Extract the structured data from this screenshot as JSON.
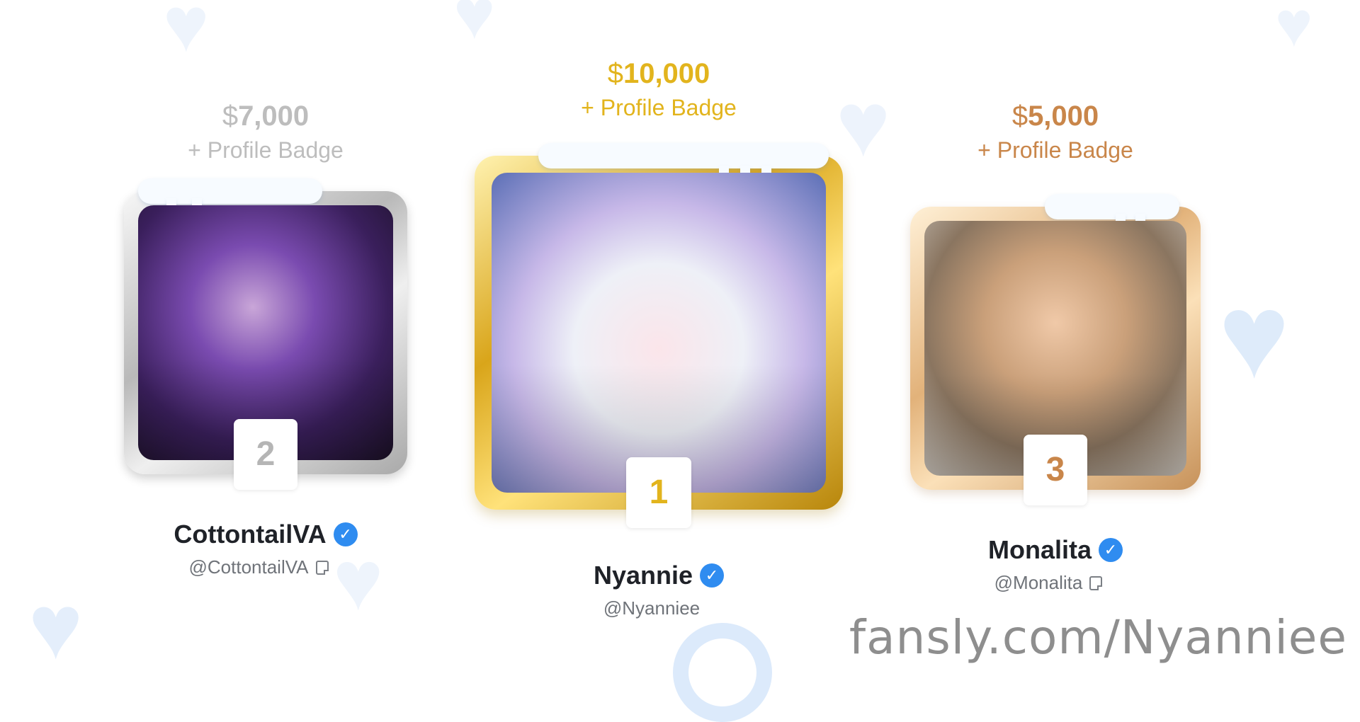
{
  "podium": [
    {
      "place": "second",
      "currency": "$",
      "amount": "7,000",
      "reward": "+ Profile Badge",
      "rank": "2",
      "name": "CottontailVA",
      "handle": "@CottontailVA",
      "verified": true,
      "frame_color": "#bdbdbd"
    },
    {
      "place": "first",
      "currency": "$",
      "amount": "10,000",
      "reward": "+ Profile Badge",
      "rank": "1",
      "name": "Nyannie",
      "handle": "@Nyanniee",
      "verified": true,
      "frame_color": "#e2b41d"
    },
    {
      "place": "third",
      "currency": "$",
      "amount": "5,000",
      "reward": "+ Profile Badge",
      "rank": "3",
      "name": "Monalita",
      "handle": "@Monalita",
      "verified": true,
      "frame_color": "#c9864a"
    }
  ],
  "watermark": "fansly.com/Nyanniee",
  "icons": {
    "verified": "verified-check-icon",
    "note": "note-icon",
    "background": "heart-icon"
  },
  "colors": {
    "verified": "#2f8cf0",
    "name": "#1f2228",
    "handle": "#6f7379"
  }
}
